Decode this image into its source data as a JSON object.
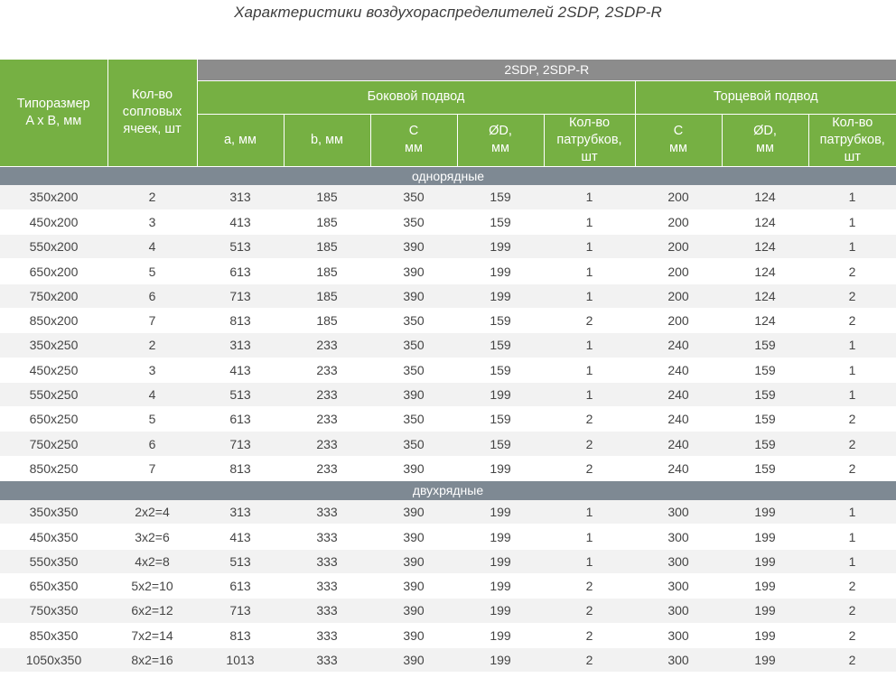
{
  "title": "Характеристики воздухораспределителей 2SDP, 2SDP-R",
  "header": {
    "size_col": "Типоразмер\nA x B, мм",
    "cells_col": "Кол-во\nсопловых\nячеек, шт",
    "group": "2SDP, 2SDP-R",
    "side": "Боковой подвод",
    "end": "Торцевой подвод",
    "a": "a, мм",
    "b": "b, мм",
    "c": "C\nмм",
    "d": "ØD,\nмм",
    "n": "Кол-во\nпатрубков,\nшт",
    "c2": "C\nмм",
    "d2": "ØD,\nмм",
    "n2": "Кол-во\nпатрубков,\nшт"
  },
  "sections": [
    {
      "label": "однорядные",
      "rows": [
        [
          "350x200",
          "2",
          "313",
          "185",
          "350",
          "159",
          "1",
          "200",
          "124",
          "1"
        ],
        [
          "450x200",
          "3",
          "413",
          "185",
          "350",
          "159",
          "1",
          "200",
          "124",
          "1"
        ],
        [
          "550x200",
          "4",
          "513",
          "185",
          "390",
          "199",
          "1",
          "200",
          "124",
          "1"
        ],
        [
          "650x200",
          "5",
          "613",
          "185",
          "390",
          "199",
          "1",
          "200",
          "124",
          "2"
        ],
        [
          "750x200",
          "6",
          "713",
          "185",
          "390",
          "199",
          "1",
          "200",
          "124",
          "2"
        ],
        [
          "850x200",
          "7",
          "813",
          "185",
          "350",
          "159",
          "2",
          "200",
          "124",
          "2"
        ],
        [
          "350x250",
          "2",
          "313",
          "233",
          "350",
          "159",
          "1",
          "240",
          "159",
          "1"
        ],
        [
          "450x250",
          "3",
          "413",
          "233",
          "350",
          "159",
          "1",
          "240",
          "159",
          "1"
        ],
        [
          "550x250",
          "4",
          "513",
          "233",
          "390",
          "199",
          "1",
          "240",
          "159",
          "1"
        ],
        [
          "650x250",
          "5",
          "613",
          "233",
          "350",
          "159",
          "2",
          "240",
          "159",
          "2"
        ],
        [
          "750x250",
          "6",
          "713",
          "233",
          "350",
          "159",
          "2",
          "240",
          "159",
          "2"
        ],
        [
          "850x250",
          "7",
          "813",
          "233",
          "390",
          "199",
          "2",
          "240",
          "159",
          "2"
        ]
      ]
    },
    {
      "label": "двухрядные",
      "rows": [
        [
          "350x350",
          "2x2=4",
          "313",
          "333",
          "390",
          "199",
          "1",
          "300",
          "199",
          "1"
        ],
        [
          "450x350",
          "3x2=6",
          "413",
          "333",
          "390",
          "199",
          "1",
          "300",
          "199",
          "1"
        ],
        [
          "550x350",
          "4x2=8",
          "513",
          "333",
          "390",
          "199",
          "1",
          "300",
          "199",
          "1"
        ],
        [
          "650x350",
          "5x2=10",
          "613",
          "333",
          "390",
          "199",
          "2",
          "300",
          "199",
          "2"
        ],
        [
          "750x350",
          "6x2=12",
          "713",
          "333",
          "390",
          "199",
          "2",
          "300",
          "199",
          "2"
        ],
        [
          "850x350",
          "7x2=14",
          "813",
          "333",
          "390",
          "199",
          "2",
          "300",
          "199",
          "2"
        ],
        [
          "1050x350",
          "8x2=16",
          "1013",
          "333",
          "390",
          "199",
          "2",
          "300",
          "199",
          "2"
        ]
      ]
    }
  ],
  "colors": {
    "header_green": "#76b043",
    "group_gray": "#8c8c8c",
    "section_gray": "#7e8993",
    "row_alt": "#f2f2f2"
  }
}
